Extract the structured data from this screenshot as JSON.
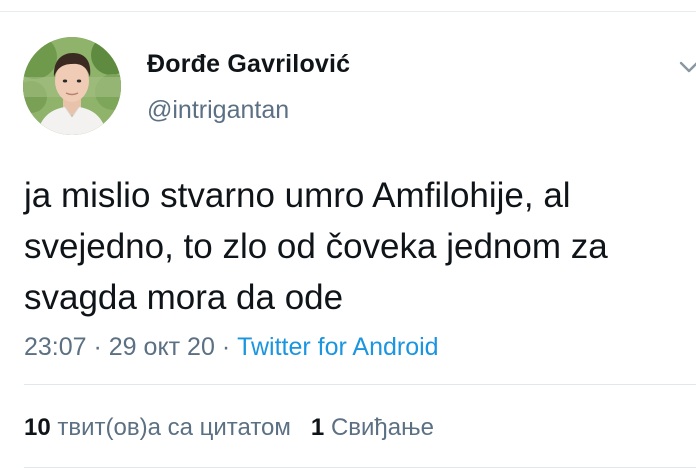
{
  "author": {
    "name": "Đorđe Gavrilović",
    "handle": "@intrigantan",
    "avatar_icon": "profile-photo"
  },
  "tweet": {
    "lines": [
      "ja mislio stvarno umro Amfilohije, al",
      "svejedno, to zlo od čoveka jednom za",
      "svagda mora da ode"
    ],
    "time": "23:07",
    "separator": " · ",
    "date": "29 окт 20",
    "source": "Twitter for Android"
  },
  "stats": {
    "quote_count": "10",
    "quote_label": "твит(ов)а са цитатом",
    "like_count": "1",
    "like_label": "Свиђање"
  },
  "colors": {
    "text": "#0f1419",
    "secondary": "#5b7083",
    "link": "#1b95e0",
    "divider": "#e1e8ed"
  }
}
